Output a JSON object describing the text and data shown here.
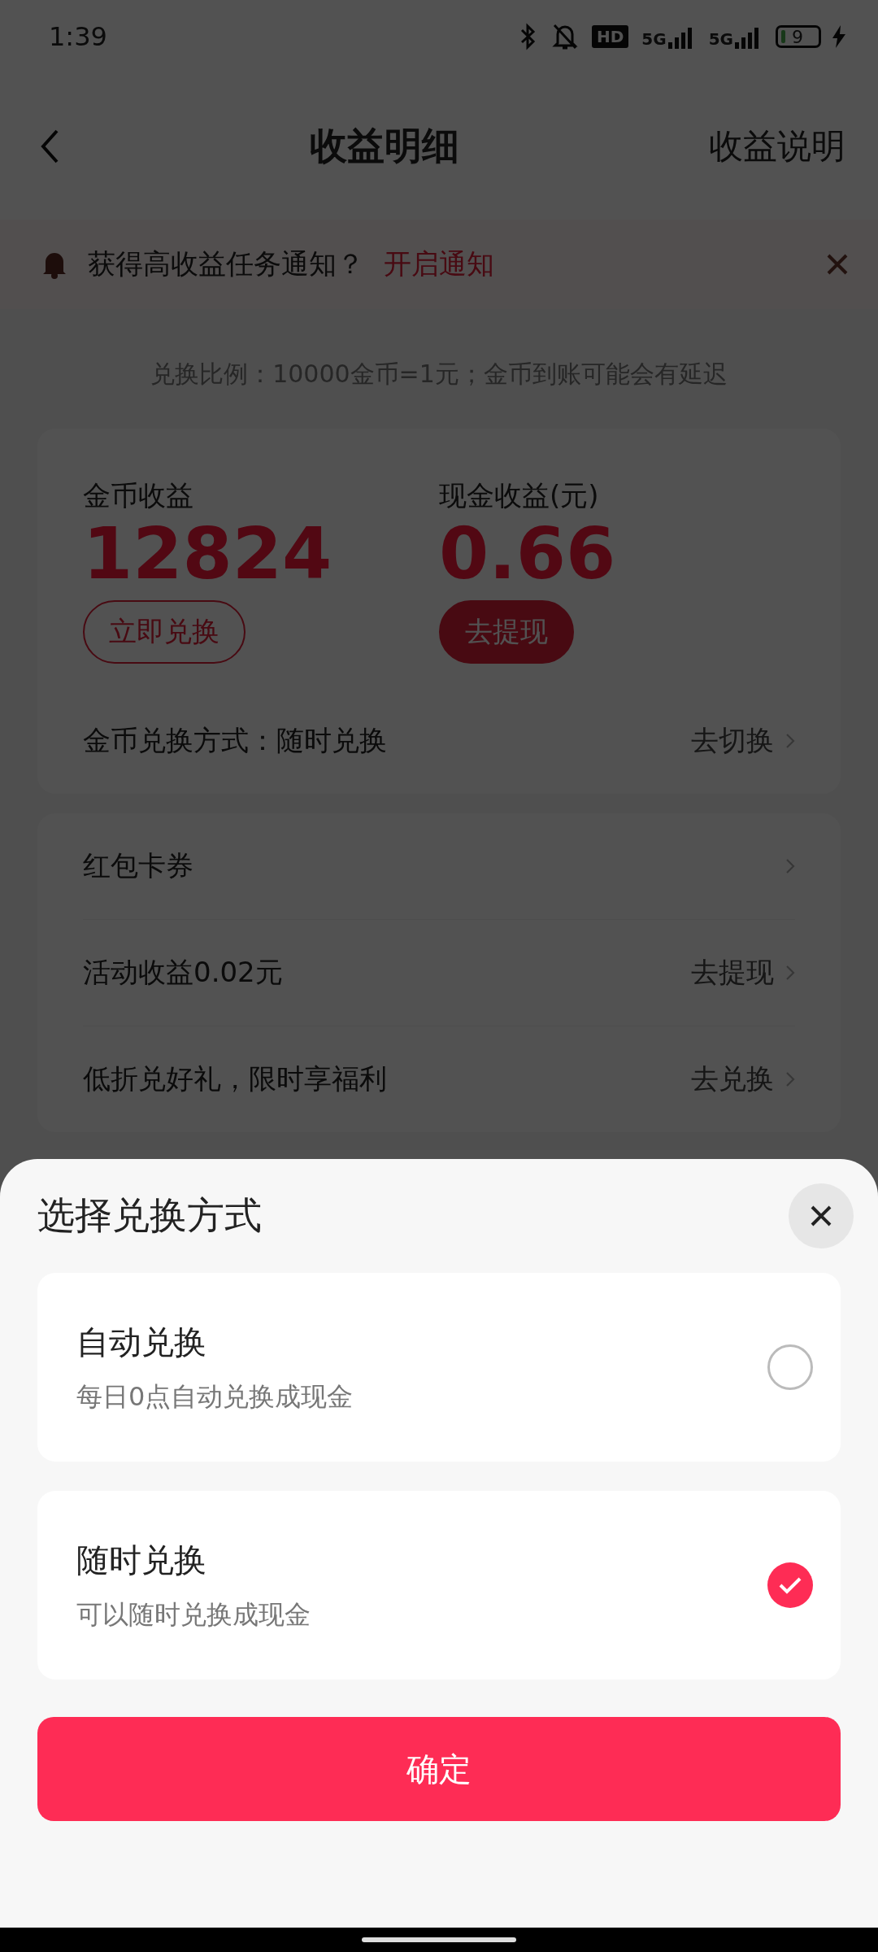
{
  "status_bar": {
    "time": "1:39",
    "hd": "HD",
    "networks": [
      "5G",
      "5G"
    ],
    "battery": "9"
  },
  "header": {
    "title": "收益明细",
    "action": "收益说明"
  },
  "notice": {
    "text": "获得高收益任务通知？",
    "link": "开启通知"
  },
  "ratio_note": "兑换比例：10000金币=1元；金币到账可能会有延迟",
  "earnings": [
    {
      "label": "金币收益",
      "value": "12824",
      "button": "立即兑换",
      "kind": "outline"
    },
    {
      "label": "现金收益(元)",
      "value": "0.66",
      "button": "去提现",
      "kind": "filled"
    }
  ],
  "exchange_mode": {
    "label": "金币兑换方式：随时兑换",
    "action": "去切换"
  },
  "list": [
    {
      "label": "红包卡券"
    },
    {
      "label": "活动收益0.02元",
      "action": "去提现"
    },
    {
      "label": "低折兑好礼，限时享福利",
      "action": "去兑换"
    }
  ],
  "sheet": {
    "title": "选择兑换方式",
    "options": [
      {
        "title": "自动兑换",
        "subtitle": "每日0点自动兑换成现金",
        "selected": false
      },
      {
        "title": "随时兑换",
        "subtitle": "可以随时兑换成现金",
        "selected": true
      }
    ],
    "confirm": "确定"
  }
}
